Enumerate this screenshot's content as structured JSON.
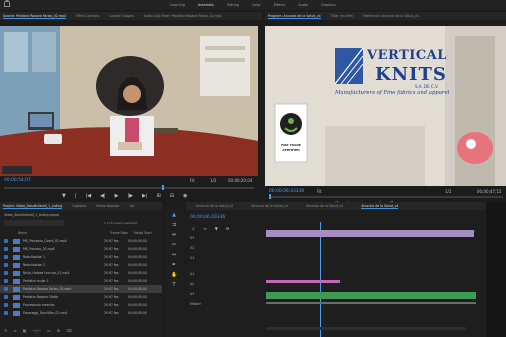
{
  "workspaces": [
    "Learning",
    "Assembly",
    "Editing",
    "Color",
    "Effects",
    "Audio",
    "Graphics"
  ],
  "source_tabs": [
    "Source: Pediatra Rosana Farias_02.mp4",
    "Effect Controls",
    "Lumetri Scopes",
    "Audio Clip Mixer: Pediatra Rosana Farias_02.mp4"
  ],
  "source": {
    "timecode": "00;00;54;07",
    "fit": "Fit",
    "duration": "00;00;20;04",
    "page": "1/2"
  },
  "program_tabs": [
    "Program: Anuncio de la Salud_v4",
    "Titler (no title)",
    "Reference: Anuncio de la Salud_v4"
  ],
  "program": {
    "timecode": "00;00;06;43336",
    "fit": "Fit",
    "page": "1/2",
    "duration": "00;00;47;15",
    "brand_line1": "VERTICAL",
    "brand_line2": "KNITS",
    "brand_sub": "S.A. DE C.V.",
    "brand_tag": "Manufacturers of Fine fabrics and apparel",
    "badge_line1": "FAIR TRADE",
    "badge_line2": "CERTIFIED"
  },
  "project_tabs": [
    "Project: Video_SaludInfantil_1_Listing",
    "Captions",
    "Media Browser",
    "Lib"
  ],
  "project": {
    "folder": "Video_SaludInfantil_1_Listing.prproj",
    "count": "1 of 16 items selected",
    "columns": [
      "Name",
      "Frame Rate",
      "Media Start"
    ],
    "items": [
      {
        "name": "ME_Processo_Coord_02.mp4",
        "fr": "29.97 fps",
        "ms": "00;00;00;00"
      },
      {
        "name": "ME_Proceso_02.mp4",
        "fr": "29.97 fps",
        "ms": "00;00;00;00"
      },
      {
        "name": "Nebulization 1",
        "fr": "29.97 fps",
        "ms": "00;00;00;00"
      },
      {
        "name": "Nebulization 2",
        "fr": "29.97 fps",
        "ms": "00;00;00;00"
      },
      {
        "name": "Ninja_Hotsea Lectura_01.mp4",
        "fr": "29.97 fps",
        "ms": "00;00;00;00"
      },
      {
        "name": "Pediatra mujer 1",
        "fr": "29.97 fps",
        "ms": "00;00;00;00"
      },
      {
        "name": "Pediatra Rosana Farias_02.mp4",
        "fr": "29.97 fps",
        "ms": "00;00;00;00"
      },
      {
        "name": "Pediatra Rosana Sibilia",
        "fr": "29.97 fps",
        "ms": "00;00;00;00"
      },
      {
        "name": "Procesando mezclas",
        "fr": "29.97 fps",
        "ms": "00;00;00;00"
      },
      {
        "name": "Pacaraggi_TouchBar_02.mp4",
        "fr": "29.97 fps",
        "ms": "00;00;00;00"
      }
    ]
  },
  "timeline_tabs": [
    "Anuncio de la Salud_v2",
    "Anuncio de la Salud_v1",
    "Anuncio de la Salud_v3",
    "Anuncio de la Salud_v4"
  ],
  "timeline": {
    "timecode": "00;00;06;43336",
    "tracks": [
      "V3",
      "V2",
      "V1",
      "A1",
      "A2",
      "A3",
      "Master"
    ]
  },
  "colors": {
    "accent": "#3f8fe0",
    "timecode": "#4b9bf0",
    "clip_video": "#a68ec0",
    "clip_pink": "#c068b9",
    "clip_audio": "#3f9a55"
  }
}
